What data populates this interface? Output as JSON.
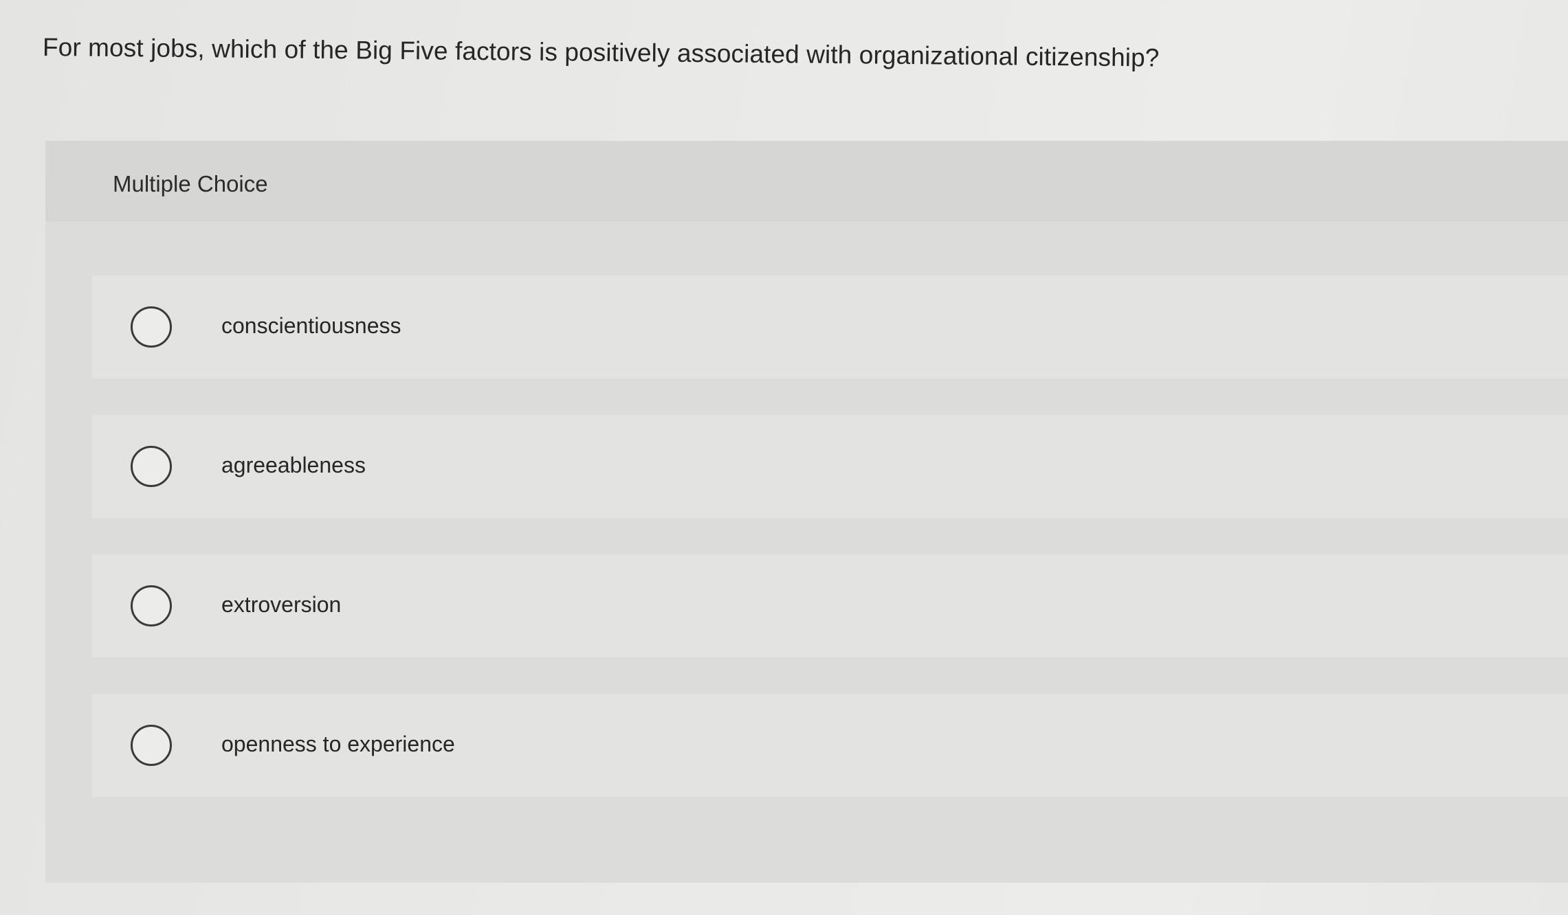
{
  "question": {
    "text": "For most jobs, which of the Big Five factors is positively associated with organizational citizenship?"
  },
  "multiple_choice": {
    "label": "Multiple Choice",
    "options": [
      {
        "label": "conscientiousness"
      },
      {
        "label": "agreeableness"
      },
      {
        "label": "extroversion"
      },
      {
        "label": "openness to experience"
      }
    ]
  },
  "colors": {
    "background": "#e8e8e6",
    "panel": "#dcdcda",
    "option_row": "#e3e3e1",
    "radio_border": "#3a3a3a",
    "text": "#262626"
  },
  "icons": {
    "radio": "radio-unchecked-icon"
  }
}
